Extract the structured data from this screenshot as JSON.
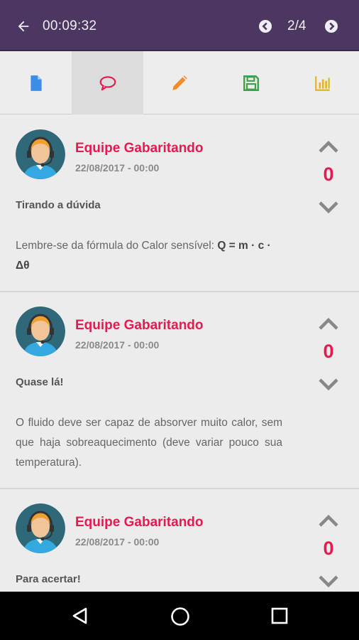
{
  "topbar": {
    "timer": "00:09:32",
    "pagination": "2/4",
    "background": "#4b3760"
  },
  "tabs": [
    {
      "icon": "document-icon",
      "color": "#3b8de8"
    },
    {
      "icon": "comment-icon",
      "color": "#e8194e",
      "active": true
    },
    {
      "icon": "pencil-icon",
      "color": "#f28c28"
    },
    {
      "icon": "save-icon",
      "color": "#3aa24a"
    },
    {
      "icon": "chart-icon",
      "color": "#e5b321"
    }
  ],
  "comments": [
    {
      "author": "Equipe Gabaritando",
      "date": "22/08/2017 - 00:00",
      "score": "0",
      "title": "Tirando a dúvida",
      "body_prefix": "Lembre-se da fórmula do Calor sensível: ",
      "body_formula": "Q = m · c · Δθ"
    },
    {
      "author": "Equipe Gabaritando",
      "date": "22/08/2017 - 00:00",
      "score": "0",
      "title": "Quase lá!",
      "body": "O fluido deve ser capaz de absorver muito calor, sem que haja sobreaquecimento (deve variar pouco sua temperatura)."
    },
    {
      "author": "Equipe Gabaritando",
      "date": "22/08/2017 - 00:00",
      "score": "0",
      "title": "Para acertar!"
    }
  ],
  "colors": {
    "accent": "#e8194e",
    "navbar": "#000000"
  }
}
